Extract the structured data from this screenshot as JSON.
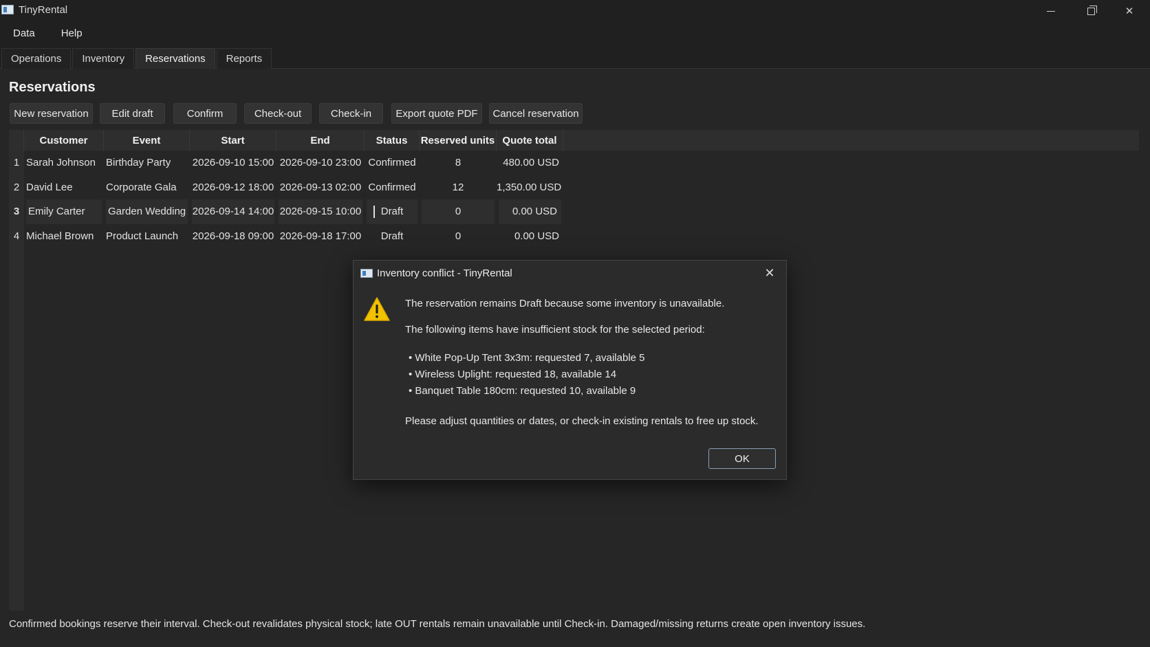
{
  "app": {
    "title": "TinyRental",
    "icon": "app-icon"
  },
  "menu": [
    "Data",
    "Help"
  ],
  "tabs": [
    {
      "label": "Operations",
      "active": false
    },
    {
      "label": "Inventory",
      "active": false
    },
    {
      "label": "Reservations",
      "active": true
    },
    {
      "label": "Reports",
      "active": false
    }
  ],
  "page": {
    "title": "Reservations"
  },
  "toolbar": [
    "New reservation",
    "Edit draft",
    "Confirm",
    "Check-out",
    "Check-in",
    "Export quote PDF",
    "Cancel reservation"
  ],
  "table": {
    "columns": [
      "Customer",
      "Event",
      "Start",
      "End",
      "Status",
      "Reserved units",
      "Quote total"
    ],
    "rows": [
      {
        "num": "1",
        "customer": "Sarah Johnson",
        "event": "Birthday Party",
        "start": "2026-09-10 15:00",
        "end": "2026-09-10 23:00",
        "status": "Confirmed",
        "units": "8",
        "total": "480.00 USD",
        "selected": false
      },
      {
        "num": "2",
        "customer": "David Lee",
        "event": "Corporate Gala",
        "start": "2026-09-12 18:00",
        "end": "2026-09-13 02:00",
        "status": "Confirmed",
        "units": "12",
        "total": "1,350.00 USD",
        "selected": false
      },
      {
        "num": "3",
        "customer": "Emily Carter",
        "event": "Garden Wedding",
        "start": "2026-09-14 14:00",
        "end": "2026-09-15 10:00",
        "status": "Draft",
        "units": "0",
        "total": "0.00 USD",
        "selected": true
      },
      {
        "num": "4",
        "customer": "Michael Brown",
        "event": "Product Launch",
        "start": "2026-09-18 09:00",
        "end": "2026-09-18 17:00",
        "status": "Draft",
        "units": "0",
        "total": "0.00 USD",
        "selected": false
      }
    ]
  },
  "status_bar": "Confirmed bookings reserve their interval. Check-out revalidates physical stock; late OUT rentals remain unavailable until Check-in. Damaged/missing returns create open inventory issues.",
  "dialog": {
    "title": "Inventory conflict - TinyRental",
    "icon": "warning-icon",
    "message": "The reservation remains Draft because some inventory is unavailable.",
    "intro": "The following items have insufficient stock for the selected period:",
    "items": [
      "• White Pop-Up Tent 3x3m: requested 7, available 5",
      "• Wireless Uplight: requested 18, available 14",
      "• Banquet Table 180cm: requested 10, available 9"
    ],
    "footer": "Please adjust quantities or dates, or check-in existing rentals to free up stock.",
    "ok_label": "OK"
  },
  "colors": {
    "background": "#202020",
    "panel": "#262626",
    "warning": "#f2c200",
    "ok_border": "#8aa0b4"
  }
}
